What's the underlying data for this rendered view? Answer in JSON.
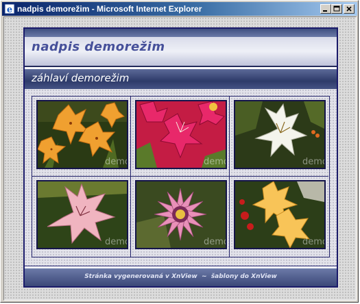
{
  "window": {
    "title": "nadpis demorežim - Microsoft Internet Explorer",
    "icon": "internet-explorer-icon",
    "buttons": [
      "minimize-icon",
      "maximize-icon",
      "close-icon"
    ],
    "title_bar_color": "#0a246a"
  },
  "page": {
    "site_title": "nadpis demorežim",
    "section_title": "záhlaví demorežim",
    "accent_color": "#1a1a6a",
    "thumbnails": [
      {
        "watermark": "demo",
        "subject": "orange lilies"
      },
      {
        "watermark": "demo",
        "subject": "red lilies"
      },
      {
        "watermark": "demo",
        "subject": "white lily"
      },
      {
        "watermark": "demo",
        "subject": "pink lily"
      },
      {
        "watermark": "demo",
        "subject": "pink gazania"
      },
      {
        "watermark": "demo",
        "subject": "yellow lilies"
      }
    ],
    "footer": {
      "prefix": "Stránka vygenerovaná v ",
      "link1": "XnView",
      "separator": "  ~  ",
      "middle": "šablony do ",
      "link2": "XnView"
    }
  }
}
